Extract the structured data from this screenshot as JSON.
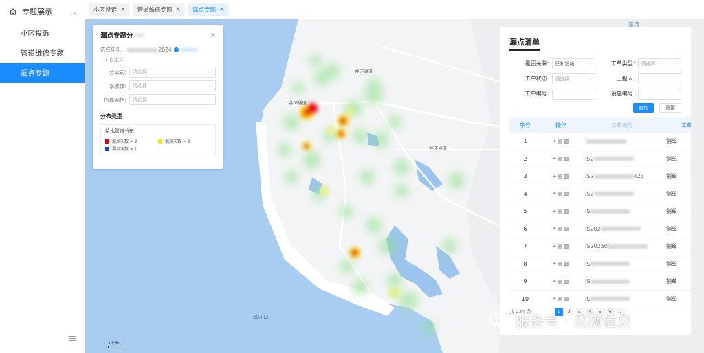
{
  "sidebar": {
    "header": "专题展示",
    "items": [
      {
        "label": "小区投诉",
        "active": false
      },
      {
        "label": "管道维修专题",
        "active": false
      },
      {
        "label": "漏点专题",
        "active": true
      }
    ],
    "footer_icon": "menu-icon"
  },
  "tabs": [
    {
      "label": "小区投诉",
      "active": false
    },
    {
      "label": "管道维修专题",
      "active": false
    },
    {
      "label": "漏点专题",
      "active": true
    }
  ],
  "map": {
    "labels": [
      "东湾",
      "井环通道",
      "井环通道",
      "井环通道",
      "珠江口",
      "1千米"
    ]
  },
  "dist_panel": {
    "title": "漏点专题分",
    "year_label": "选择年份:",
    "year_value": "2024",
    "custom_label": "自定义",
    "filters": [
      {
        "label": "分公司:",
        "placeholder": "请选择"
      },
      {
        "label": "水表体:",
        "placeholder": "请选择"
      },
      {
        "label": "所属网格:",
        "placeholder": "请选择"
      }
    ],
    "section_title": "分布类型",
    "legend_title": "给水管道分布",
    "legend": [
      {
        "label": "漏点次数 > 2",
        "color": "#e5001c"
      },
      {
        "label": "漏点次数 = 2",
        "color": "#f4ec00"
      },
      {
        "label": "漏点次数 = 1",
        "color": "#1a47d6"
      }
    ]
  },
  "list_panel": {
    "title": "漏点清单",
    "form": {
      "related_label": "是否关联:",
      "related_value": "已和设施...",
      "type_label": "工单类型:",
      "type_placeholder": "请选择",
      "status_label": "工单状态:",
      "status_placeholder": "请选择",
      "reporter_label": "上报人:",
      "order_no_label": "工单编号:",
      "facility_label": "设施编号:"
    },
    "query_button": "查询",
    "reset_button": "重置",
    "columns": [
      "序号",
      "操作",
      "工单编号",
      "工单状"
    ],
    "rows": [
      {
        "no": "1",
        "code": "I",
        "status": "销单"
      },
      {
        "no": "2",
        "code": "IS2",
        "status": "销单"
      },
      {
        "no": "3",
        "code": "IS2",
        "code_suffix": "423",
        "status": "销单"
      },
      {
        "no": "4",
        "code": "IS2",
        "status": "销单"
      },
      {
        "no": "5",
        "code": "IS",
        "status": "销单"
      },
      {
        "no": "6",
        "code": "IS202",
        "status": "销单"
      },
      {
        "no": "7",
        "code": "IS20250",
        "status": "销单"
      },
      {
        "no": "8",
        "code": "IS",
        "status": "销单"
      },
      {
        "no": "9",
        "code": "IS",
        "status": "销单"
      },
      {
        "no": "10",
        "code": "IS",
        "status": "销单"
      }
    ],
    "total": "共 234 条",
    "pages": [
      "1",
      "2",
      "3",
      "4",
      "5",
      "6",
      "7"
    ],
    "current_page": "1"
  },
  "watermark": {
    "text": "服务号 · 杰狮信息"
  }
}
